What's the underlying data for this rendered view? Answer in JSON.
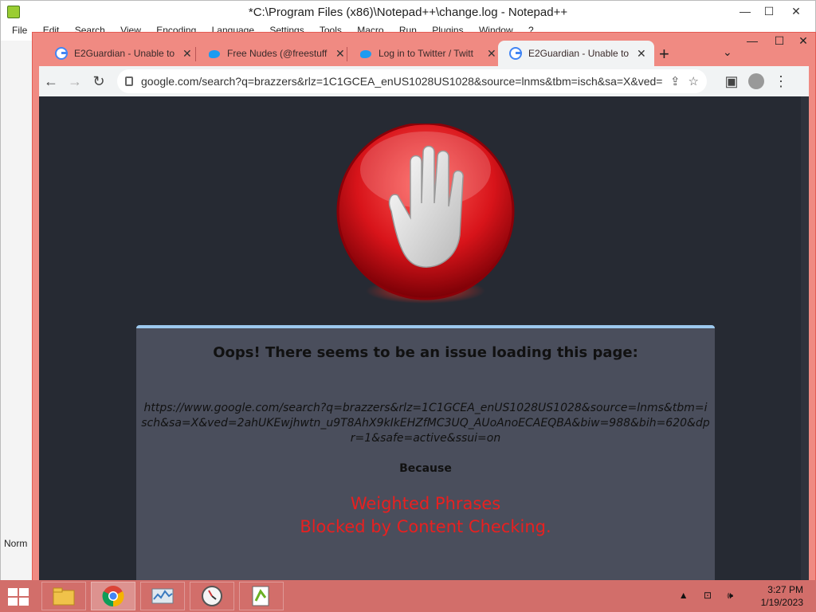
{
  "notepad": {
    "title": "*C:\\Program Files (x86)\\Notepad++\\change.log - Notepad++",
    "menu": [
      "File",
      "Edit",
      "Search",
      "View",
      "Encoding",
      "Language",
      "Settings",
      "Tools",
      "Macro",
      "Run",
      "Plugins",
      "Window",
      "?"
    ],
    "status_text": "Norm",
    "minimize": "—",
    "maximize": "☐",
    "close": "✕"
  },
  "chrome": {
    "tabs": [
      {
        "title": "E2Guardian - Unable to",
        "icon": "google-icon",
        "active": false
      },
      {
        "title": "Free Nudes (@freestuff",
        "icon": "twitter-icon",
        "active": false
      },
      {
        "title": "Log in to Twitter / Twitt",
        "icon": "twitter-icon",
        "active": false
      },
      {
        "title": "E2Guardian - Unable to",
        "icon": "google-icon",
        "active": true
      }
    ],
    "tab_close": "✕",
    "new_tab": "+",
    "tab_search": "⌄",
    "minimize": "—",
    "maximize": "☐",
    "close": "✕",
    "back": "←",
    "forward": "→",
    "reload": "↻",
    "address": "google.com/search?q=brazzers&rlz=1C1GCEA_enUS1028US1028&source=lnms&tbm=isch&sa=X&ved=2...",
    "share": "⇪",
    "bookmark": "☆",
    "sidepanel": "▣",
    "menu": "⋮"
  },
  "page": {
    "heading": "Oops! There seems to be an issue loading this page:",
    "url": "https://www.google.com/search?q=brazzers&rlz=1C1GCEA_enUS1028US1028&source=lnms&tbm=isch&sa=X&ved=2ahUKEwjhwtn_u9T8AhX9kIkEHZfMC3UQ_AUoAnoECAEQBA&biw=988&bih=620&dpr=1&safe=active&ssui=on",
    "because": "Because",
    "reason_line1": "Weighted Phrases",
    "reason_line2": "Blocked by Content Checking."
  },
  "taskbar": {
    "time": "3:27 PM",
    "date": "1/19/2023",
    "tray_up": "▲",
    "apps": [
      "file-explorer",
      "chrome",
      "task-manager",
      "clock",
      "notepad-plus-plus"
    ]
  },
  "colors": {
    "stop_red": "#d8141a",
    "reason_red": "#e82020",
    "chrome_frame": "#f08a82",
    "page_bg": "#262a33",
    "panel_bg": "#4a4e5c"
  }
}
